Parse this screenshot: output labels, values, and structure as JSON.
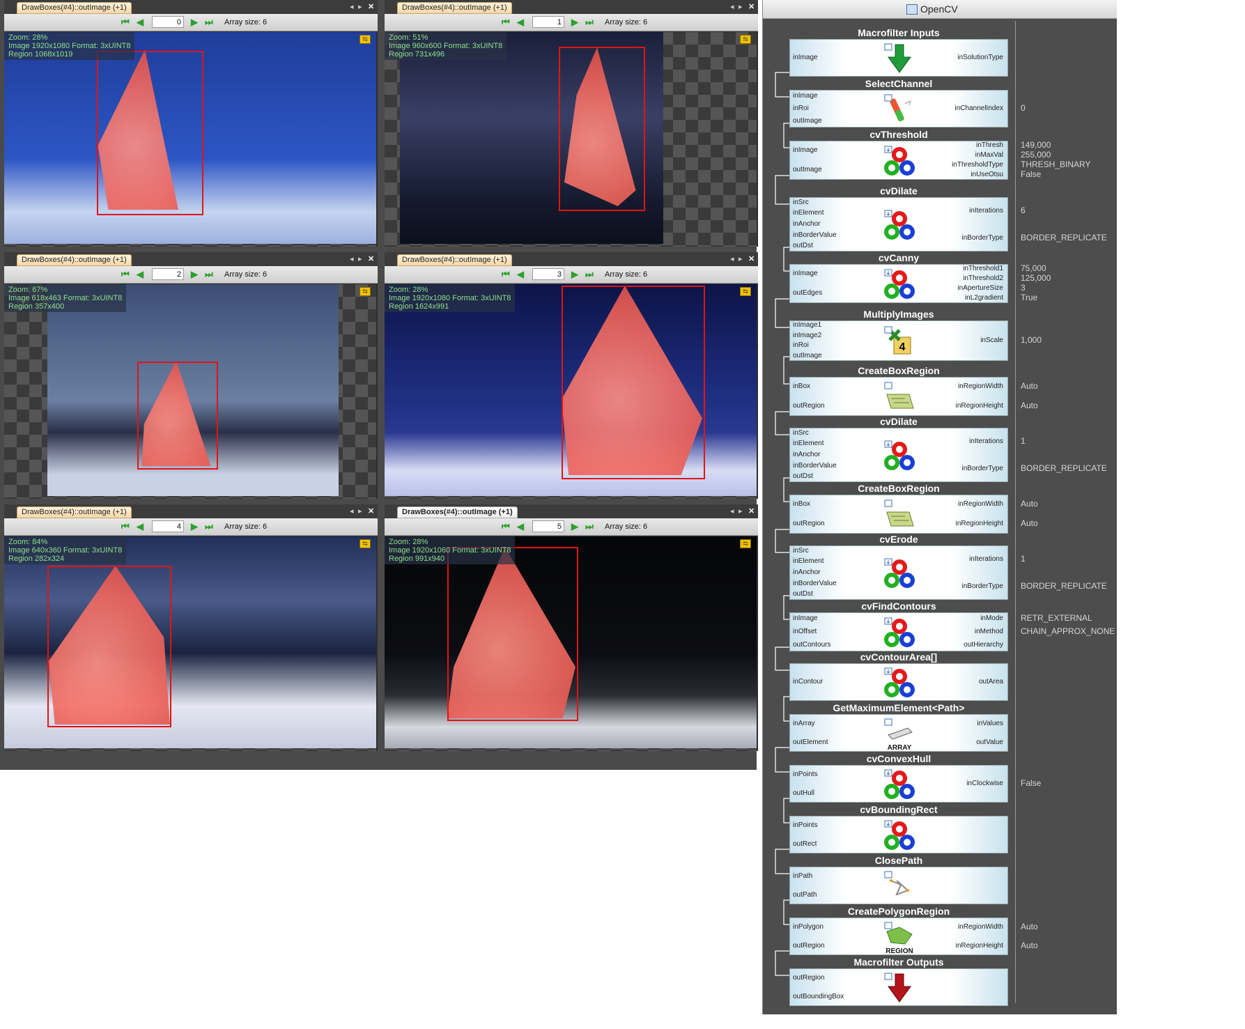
{
  "viewer": {
    "panes": [
      {
        "tab": "DrawBoxes(#4)::outImage (+1)",
        "index": "0",
        "array_size": "Array size: 6",
        "zoom": "Zoom: 28%",
        "image": "Image 1920x1080 Format: 3xUINT8",
        "region": "Region 1068x1019"
      },
      {
        "tab": "DrawBoxes(#4)::outImage (+1)",
        "index": "1",
        "array_size": "Array size: 6",
        "zoom": "Zoom: 51%",
        "image": "Image 960x600 Format: 3xUINT8",
        "region": "Region 731x496"
      },
      {
        "tab": "DrawBoxes(#4)::outImage (+1)",
        "index": "2",
        "array_size": "Array size: 6",
        "zoom": "Zoom: 67%",
        "image": "Image 618x463 Format: 3xUINT8",
        "region": "Region 357x400"
      },
      {
        "tab": "DrawBoxes(#4)::outImage (+1)",
        "index": "3",
        "array_size": "Array size: 6",
        "zoom": "Zoom: 28%",
        "image": "Image 1920x1080 Format: 3xUINT8",
        "region": "Region 1624x991"
      },
      {
        "tab": "DrawBoxes(#4)::outImage (+1)",
        "index": "4",
        "array_size": "Array size: 6",
        "zoom": "Zoom: 84%",
        "image": "Image 640x360 Format: 3xUINT8",
        "region": "Region 282x324"
      },
      {
        "tab": "DrawBoxes(#4)::outImage (+1)",
        "index": "5",
        "array_size": "Array size: 6",
        "zoom": "Zoom: 28%",
        "image": "Image 1920x1060 Format: 3xUINT8",
        "region": "Region 991x940"
      }
    ]
  },
  "graph": {
    "title": "OpenCV",
    "nodes": [
      {
        "title": "Macrofilter Inputs",
        "inputs": [
          "inImage"
        ],
        "outputs": [
          "inSolutionType"
        ],
        "params": [],
        "icon": "down-arrow-green-icon"
      },
      {
        "title": "SelectChannel",
        "inputs": [
          "inImage",
          "inRoi",
          "outImage"
        ],
        "outputs": [
          "inChannelIndex"
        ],
        "params": [
          "0"
        ],
        "icon": "select-channel-icon"
      },
      {
        "title": "cvThreshold",
        "inputs": [
          "inImage",
          "outImage"
        ],
        "outputs": [
          "inThresh",
          "inMaxVal",
          "inThresholdType",
          "inUseOtsu"
        ],
        "params": [
          "149,000",
          "255,000",
          "THRESH_BINARY",
          "False"
        ],
        "icon": "opencv-logo-icon"
      },
      {
        "title": "cvDilate",
        "inputs": [
          "inSrc",
          "inElement",
          "inAnchor",
          "inBorderValue",
          "outDst"
        ],
        "outputs": [
          "inIterations",
          "inBorderType"
        ],
        "params": [
          "6",
          "BORDER_REPLICATE"
        ],
        "icon": "opencv-logo-icon"
      },
      {
        "title": "cvCanny",
        "inputs": [
          "inImage",
          "outEdges"
        ],
        "outputs": [
          "inThreshold1",
          "inThreshold2",
          "inApertureSize",
          "inL2gradient"
        ],
        "params": [
          "75,000",
          "125,000",
          "3",
          "True"
        ],
        "icon": "opencv-logo-icon"
      },
      {
        "title": "MultiplyImages",
        "inputs": [
          "inImage1",
          "inImage2",
          "inRoi",
          "outImage"
        ],
        "outputs": [
          "inScale"
        ],
        "params": [
          "1,000"
        ],
        "icon": "multiply-icon"
      },
      {
        "title": "CreateBoxRegion",
        "inputs": [
          "inBox",
          "outRegion"
        ],
        "outputs": [
          "inRegionWidth",
          "inRegionHeight"
        ],
        "params": [
          "Auto",
          "Auto"
        ],
        "icon": "box-region-icon"
      },
      {
        "title": "cvDilate",
        "inputs": [
          "inSrc",
          "inElement",
          "inAnchor",
          "inBorderValue",
          "outDst"
        ],
        "outputs": [
          "inIterations",
          "inBorderType"
        ],
        "params": [
          "1",
          "BORDER_REPLICATE"
        ],
        "icon": "opencv-logo-icon"
      },
      {
        "title": "CreateBoxRegion",
        "inputs": [
          "inBox",
          "outRegion"
        ],
        "outputs": [
          "inRegionWidth",
          "inRegionHeight"
        ],
        "params": [
          "Auto",
          "Auto"
        ],
        "icon": "box-region-icon"
      },
      {
        "title": "cvErode",
        "inputs": [
          "inSrc",
          "inElement",
          "inAnchor",
          "inBorderValue",
          "outDst"
        ],
        "outputs": [
          "inIterations",
          "inBorderType"
        ],
        "params": [
          "1",
          "BORDER_REPLICATE"
        ],
        "icon": "opencv-logo-icon"
      },
      {
        "title": "cvFindContours",
        "inputs": [
          "inImage",
          "inOffset",
          "outContours"
        ],
        "outputs": [
          "inMode",
          "inMethod",
          "outHierarchy"
        ],
        "params": [
          "RETR_EXTERNAL",
          "CHAIN_APPROX_NONE"
        ],
        "icon": "opencv-logo-icon"
      },
      {
        "title": "cvContourArea[]",
        "inputs": [
          "inContour"
        ],
        "outputs": [
          "outArea"
        ],
        "params": [],
        "icon": "opencv-logo-icon"
      },
      {
        "title": "GetMaximumElement<Path>",
        "inputs": [
          "inArray",
          "outElement"
        ],
        "outputs": [
          "inValues",
          "outValue"
        ],
        "params": [],
        "icon": "array-icon",
        "icon_label": "ARRAY"
      },
      {
        "title": "cvConvexHull",
        "inputs": [
          "inPoints",
          "outHull"
        ],
        "outputs": [
          "inClockwise"
        ],
        "params": [
          "False"
        ],
        "icon": "opencv-logo-icon"
      },
      {
        "title": "cvBoundingRect",
        "inputs": [
          "inPoints",
          "outRect"
        ],
        "outputs": [],
        "params": [],
        "icon": "opencv-logo-icon"
      },
      {
        "title": "ClosePath",
        "inputs": [
          "inPath",
          "outPath"
        ],
        "outputs": [],
        "params": [],
        "icon": "close-path-icon"
      },
      {
        "title": "CreatePolygonRegion",
        "inputs": [
          "inPolygon",
          "outRegion"
        ],
        "outputs": [
          "inRegionWidth",
          "inRegionHeight"
        ],
        "params": [
          "Auto",
          "Auto"
        ],
        "icon": "polygon-region-icon",
        "icon_label": "REGION"
      },
      {
        "title": "Macrofilter Outputs",
        "inputs": [
          "outRegion",
          "outBoundingBox"
        ],
        "outputs": [],
        "params": [],
        "icon": "down-arrow-red-icon"
      }
    ]
  },
  "colors": {
    "roi": "#e01515",
    "tree": "#f0655c",
    "panel_bg": "#4d4d4d",
    "info_text": "#8fe08f"
  }
}
